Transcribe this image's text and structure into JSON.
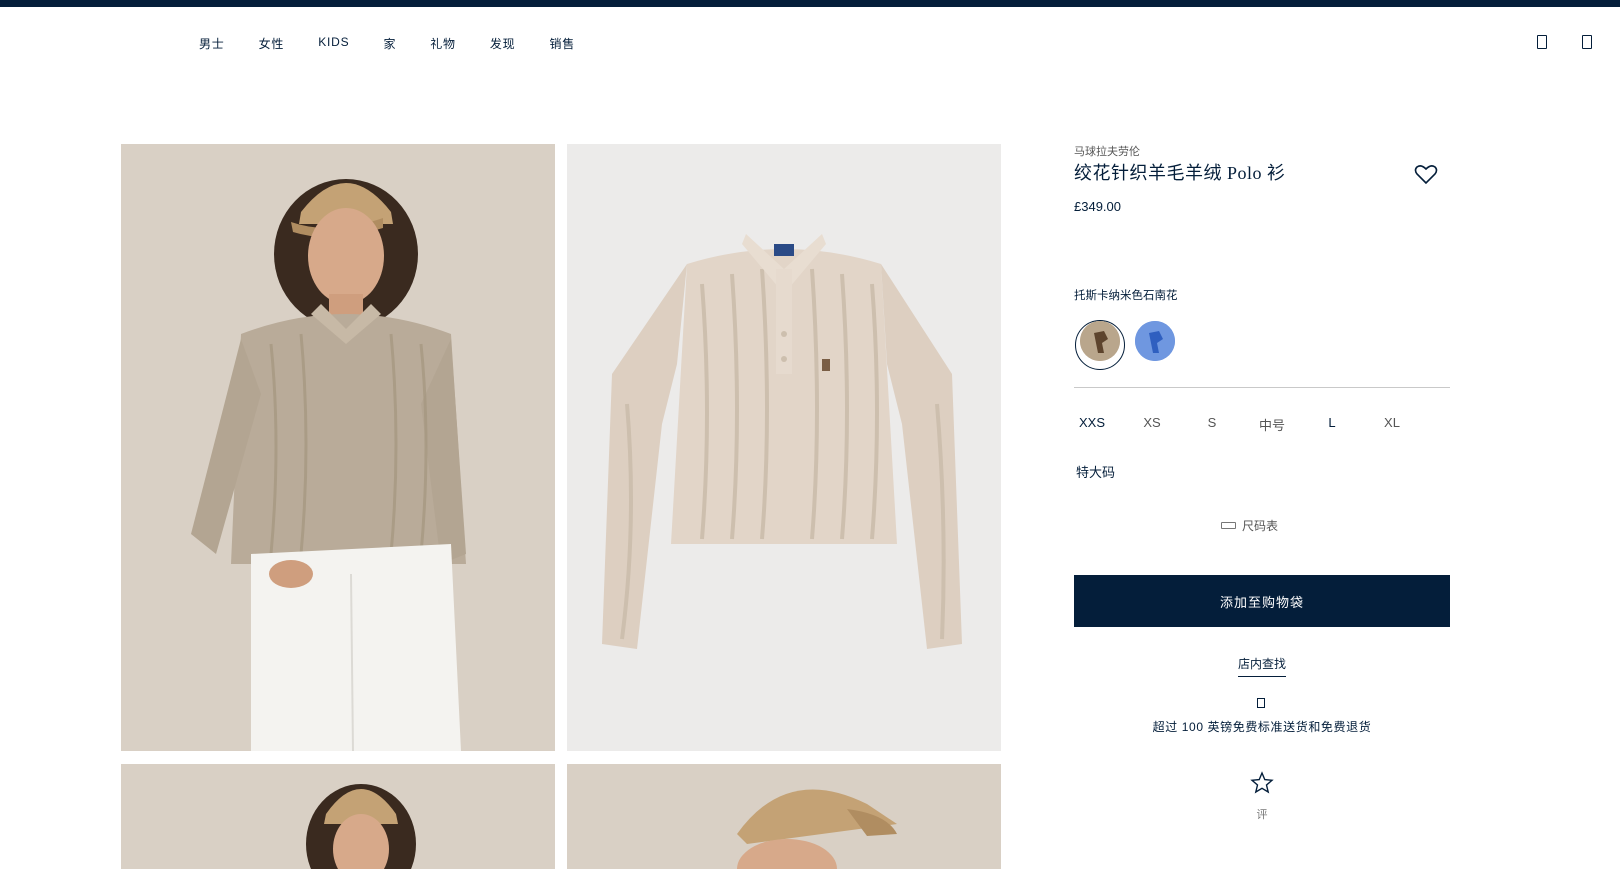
{
  "nav": {
    "items": [
      "男士",
      "女性",
      "KIDS",
      "家",
      "礼物",
      "发现",
      "销售"
    ],
    "right_icons": [
      "account-icon",
      "bag-icon"
    ]
  },
  "images": [
    {
      "name": "model-front-image",
      "alt": "model"
    },
    {
      "name": "product-flat-image",
      "alt": "product"
    },
    {
      "name": "model-detail-image",
      "alt": "model"
    },
    {
      "name": "model-cap-image",
      "alt": "model"
    }
  ],
  "product": {
    "brand": "马球拉夫劳伦",
    "title": "绞花针织羊毛羊绒 Polo 衫",
    "price": "£349.00",
    "color_name": "托斯卡纳米色石南花",
    "swatches": [
      {
        "name": "swatch-beige",
        "color": "#b9a68c",
        "selected": true
      },
      {
        "name": "swatch-blue",
        "color": "#5b87d9",
        "selected": false
      }
    ],
    "sizes": [
      "XXS",
      "XS",
      "S",
      "中号",
      "L",
      "XL"
    ],
    "selected_size": "XXS",
    "extra_size": "特大码",
    "size_chart_label": "尺码表",
    "add_to_bag_label": "添加至购物袋",
    "find_in_store_label": "店内查找",
    "shipping_text": "超过  100  英镑免费标准送货和免费退货",
    "review_label": "评"
  },
  "colors": {
    "navy": "#041e3a",
    "image_bg_warm": "#d9d0c5",
    "image_bg_cool": "#ecebea"
  }
}
